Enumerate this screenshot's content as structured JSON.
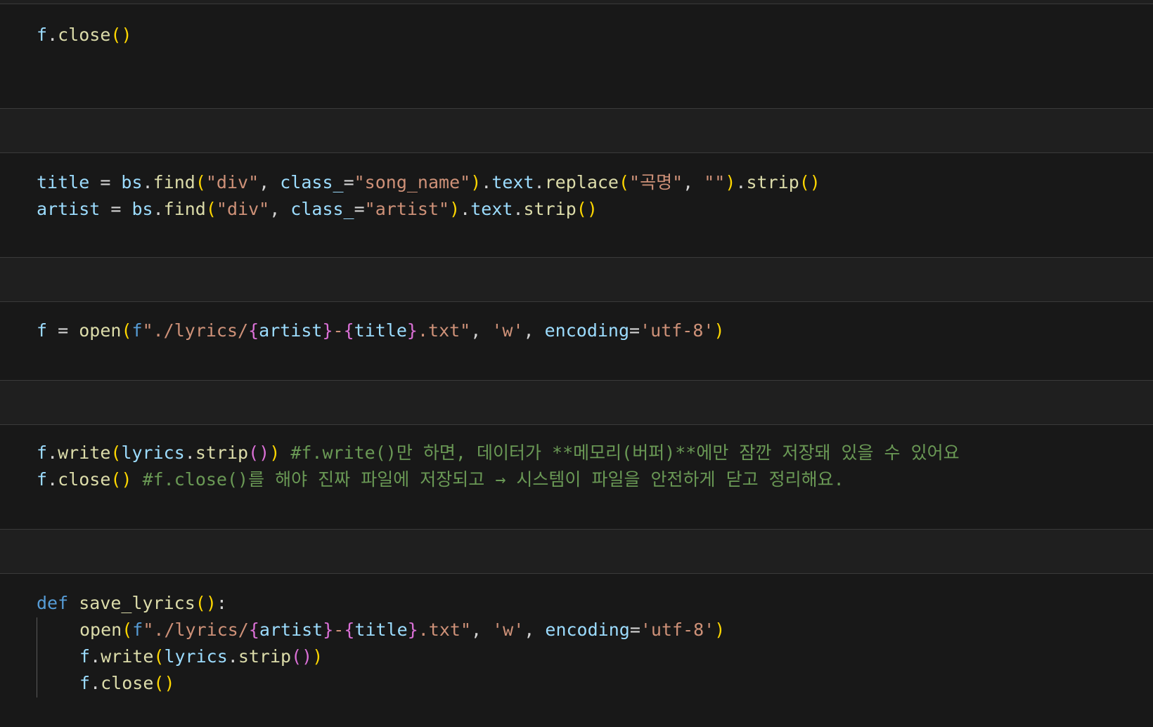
{
  "theme": {
    "background": "#1f1f1f",
    "cell_background": "#181818",
    "variable": "#9cdcfe",
    "function": "#dcdcaa",
    "string": "#ce9178",
    "keyword": "#569cd6",
    "comment": "#6a9955",
    "bracket_1": "#ffd700",
    "bracket_2": "#da70d6"
  },
  "cells": [
    {
      "lines": [
        [
          {
            "t": "f",
            "c": "v"
          },
          {
            "t": ".",
            "c": "op"
          },
          {
            "t": "close",
            "c": "fn"
          },
          {
            "t": "()",
            "c": "p"
          }
        ]
      ]
    },
    {
      "lines": [
        [
          {
            "t": "title",
            "c": "v"
          },
          {
            "t": " = ",
            "c": "op"
          },
          {
            "t": "bs",
            "c": "v"
          },
          {
            "t": ".",
            "c": "op"
          },
          {
            "t": "find",
            "c": "fn"
          },
          {
            "t": "(",
            "c": "p"
          },
          {
            "t": "\"div\"",
            "c": "s"
          },
          {
            "t": ", ",
            "c": "op"
          },
          {
            "t": "class_",
            "c": "v"
          },
          {
            "t": "=",
            "c": "op"
          },
          {
            "t": "\"song_name\"",
            "c": "s"
          },
          {
            "t": ")",
            "c": "p"
          },
          {
            "t": ".",
            "c": "op"
          },
          {
            "t": "text",
            "c": "v"
          },
          {
            "t": ".",
            "c": "op"
          },
          {
            "t": "replace",
            "c": "fn"
          },
          {
            "t": "(",
            "c": "p"
          },
          {
            "t": "\"곡명\"",
            "c": "s"
          },
          {
            "t": ", ",
            "c": "op"
          },
          {
            "t": "\"\"",
            "c": "s"
          },
          {
            "t": ")",
            "c": "p"
          },
          {
            "t": ".",
            "c": "op"
          },
          {
            "t": "strip",
            "c": "fn"
          },
          {
            "t": "()",
            "c": "p"
          }
        ],
        [
          {
            "t": "artist",
            "c": "v"
          },
          {
            "t": " = ",
            "c": "op"
          },
          {
            "t": "bs",
            "c": "v"
          },
          {
            "t": ".",
            "c": "op"
          },
          {
            "t": "find",
            "c": "fn"
          },
          {
            "t": "(",
            "c": "p"
          },
          {
            "t": "\"div\"",
            "c": "s"
          },
          {
            "t": ", ",
            "c": "op"
          },
          {
            "t": "class_",
            "c": "v"
          },
          {
            "t": "=",
            "c": "op"
          },
          {
            "t": "\"artist\"",
            "c": "s"
          },
          {
            "t": ")",
            "c": "p"
          },
          {
            "t": ".",
            "c": "op"
          },
          {
            "t": "text",
            "c": "v"
          },
          {
            "t": ".",
            "c": "op"
          },
          {
            "t": "strip",
            "c": "fn"
          },
          {
            "t": "()",
            "c": "p"
          }
        ]
      ]
    },
    {
      "lines": [
        [
          {
            "t": "f",
            "c": "v"
          },
          {
            "t": " = ",
            "c": "op"
          },
          {
            "t": "open",
            "c": "fn"
          },
          {
            "t": "(",
            "c": "p"
          },
          {
            "t": "f",
            "c": "kw"
          },
          {
            "t": "\"./lyrics/",
            "c": "s"
          },
          {
            "t": "{",
            "c": "br"
          },
          {
            "t": "artist",
            "c": "v"
          },
          {
            "t": "}",
            "c": "br"
          },
          {
            "t": "-",
            "c": "s"
          },
          {
            "t": "{",
            "c": "br"
          },
          {
            "t": "title",
            "c": "v"
          },
          {
            "t": "}",
            "c": "br"
          },
          {
            "t": ".txt\"",
            "c": "s"
          },
          {
            "t": ", ",
            "c": "op"
          },
          {
            "t": "'w'",
            "c": "s"
          },
          {
            "t": ", ",
            "c": "op"
          },
          {
            "t": "encoding",
            "c": "v"
          },
          {
            "t": "=",
            "c": "op"
          },
          {
            "t": "'utf-8'",
            "c": "s"
          },
          {
            "t": ")",
            "c": "p"
          }
        ]
      ]
    },
    {
      "lines": [
        [
          {
            "t": "f",
            "c": "v"
          },
          {
            "t": ".",
            "c": "op"
          },
          {
            "t": "write",
            "c": "fn"
          },
          {
            "t": "(",
            "c": "p"
          },
          {
            "t": "lyrics",
            "c": "v"
          },
          {
            "t": ".",
            "c": "op"
          },
          {
            "t": "strip",
            "c": "fn"
          },
          {
            "t": "()",
            "c": "p2"
          },
          {
            "t": ")",
            "c": "p"
          },
          {
            "t": " ",
            "c": "op"
          },
          {
            "t": "#f.write()만 하면, 데이터가 **메모리(버퍼)**에만 잠깐 저장돼 있을 수 있어요",
            "c": "cm"
          }
        ],
        [
          {
            "t": "f",
            "c": "v"
          },
          {
            "t": ".",
            "c": "op"
          },
          {
            "t": "close",
            "c": "fn"
          },
          {
            "t": "()",
            "c": "p"
          },
          {
            "t": " ",
            "c": "op"
          },
          {
            "t": "#f.close()를 해야 진짜 파일에 저장되고 → 시스템이 파일을 안전하게 닫고 정리해요.",
            "c": "cm"
          }
        ]
      ]
    },
    {
      "lines": [
        [
          {
            "t": "def",
            "c": "kw"
          },
          {
            "t": " ",
            "c": "op"
          },
          {
            "t": "save_lyrics",
            "c": "fn"
          },
          {
            "t": "()",
            "c": "p"
          },
          {
            "t": ":",
            "c": "op"
          }
        ],
        [
          {
            "t": "INDENT",
            "c": "ind"
          },
          {
            "t": "open",
            "c": "fn"
          },
          {
            "t": "(",
            "c": "p"
          },
          {
            "t": "f",
            "c": "kw"
          },
          {
            "t": "\"./lyrics/",
            "c": "s"
          },
          {
            "t": "{",
            "c": "br"
          },
          {
            "t": "artist",
            "c": "v"
          },
          {
            "t": "}",
            "c": "br"
          },
          {
            "t": "-",
            "c": "s"
          },
          {
            "t": "{",
            "c": "br"
          },
          {
            "t": "title",
            "c": "v"
          },
          {
            "t": "}",
            "c": "br"
          },
          {
            "t": ".txt\"",
            "c": "s"
          },
          {
            "t": ", ",
            "c": "op"
          },
          {
            "t": "'w'",
            "c": "s"
          },
          {
            "t": ", ",
            "c": "op"
          },
          {
            "t": "encoding",
            "c": "v"
          },
          {
            "t": "=",
            "c": "op"
          },
          {
            "t": "'utf-8'",
            "c": "s"
          },
          {
            "t": ")",
            "c": "p"
          }
        ],
        [
          {
            "t": "INDENT",
            "c": "ind"
          },
          {
            "t": "f",
            "c": "v"
          },
          {
            "t": ".",
            "c": "op"
          },
          {
            "t": "write",
            "c": "fn"
          },
          {
            "t": "(",
            "c": "p"
          },
          {
            "t": "lyrics",
            "c": "v"
          },
          {
            "t": ".",
            "c": "op"
          },
          {
            "t": "strip",
            "c": "fn"
          },
          {
            "t": "()",
            "c": "p2"
          },
          {
            "t": ")",
            "c": "p"
          }
        ],
        [
          {
            "t": "INDENT",
            "c": "ind"
          },
          {
            "t": "f",
            "c": "v"
          },
          {
            "t": ".",
            "c": "op"
          },
          {
            "t": "close",
            "c": "fn"
          },
          {
            "t": "()",
            "c": "p"
          }
        ]
      ]
    }
  ]
}
